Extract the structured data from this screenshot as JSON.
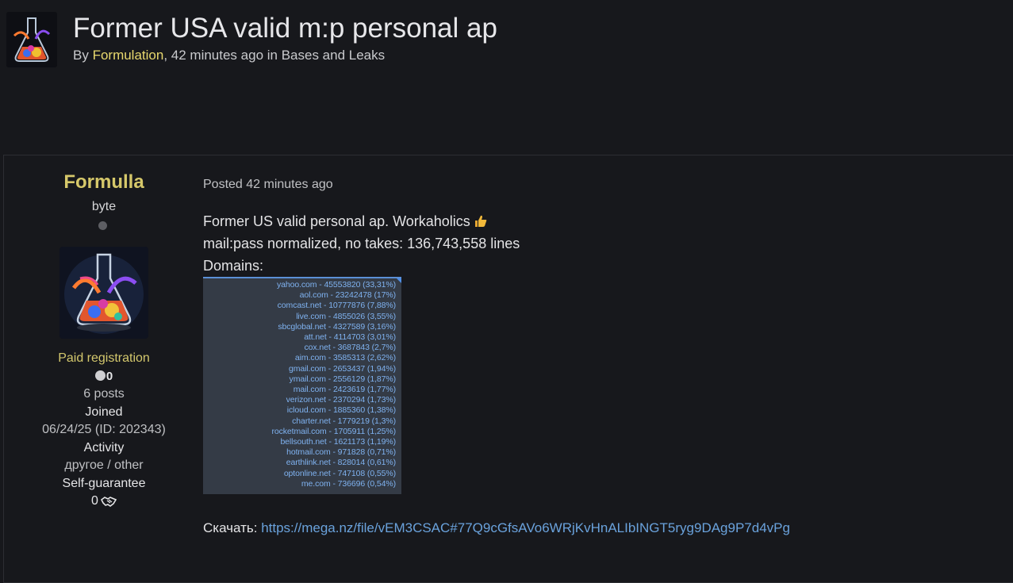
{
  "topic": {
    "title": "Former USA valid m:p personal ap",
    "meta_by": "By ",
    "author": "Formulation",
    "meta_time": ", 42 minutes ago in ",
    "forum": "Bases and Leaks"
  },
  "author_panel": {
    "name": "Formulla",
    "rank": "byte",
    "group": "Paid registration",
    "reputation": "0",
    "posts": "6 posts",
    "joined_label": "Joined",
    "joined_value": "06/24/25 (ID: 202343)",
    "activity_label": "Activity",
    "activity_value": "другое / other",
    "guarantee_label": "Self-guarantee",
    "guarantee_value": "0",
    "icons": [
      "user-avatar",
      "online-status-dot",
      "reputation-dot-icon",
      "handshake-icon"
    ]
  },
  "post": {
    "posted": "Posted 42 minutes ago",
    "line1": "Former US valid personal ap. Workaholics",
    "line2": "mail:pass normalized, no takes: 136,743,558 lines",
    "line3": "Domains:",
    "download_label": "Скачать: ",
    "download_link": "https://mega.nz/file/vEM3CSAC#77Q9cGfsAVo6WRjKvHnALIbINGT5ryg9DAg9P7d4vPg",
    "domains": [
      "yahoo.com - 45553820 (33,31%)",
      "aol.com - 23242478 (17%)",
      "comcast.net - 10777876 (7,88%)",
      "live.com - 4855026 (3,55%)",
      "sbcglobal.net - 4327589 (3,16%)",
      "att.net - 4114703 (3,01%)",
      "cox.net - 3687843 (2,7%)",
      "aim.com - 3585313 (2,62%)",
      "gmail.com - 2653437 (1,94%)",
      "ymail.com - 2556129 (1,87%)",
      "mail.com - 2423619 (1,77%)",
      "verizon.net - 2370294 (1,73%)",
      "icloud.com - 1885360 (1,38%)",
      "charter.net - 1779219 (1,3%)",
      "rocketmail.com - 1705911 (1,25%)",
      "bellsouth.net - 1621173 (1,19%)",
      "hotmail.com - 971828 (0,71%)",
      "earthlink.net - 828014 (0,61%)",
      "optonline.net - 747108 (0,55%)",
      "me.com - 736696 (0,54%)"
    ]
  },
  "colors": {
    "background": "#17181c",
    "author_accent": "#d6c86a",
    "link": "#6aa2dc",
    "domain_text": "#7fb2f0"
  }
}
